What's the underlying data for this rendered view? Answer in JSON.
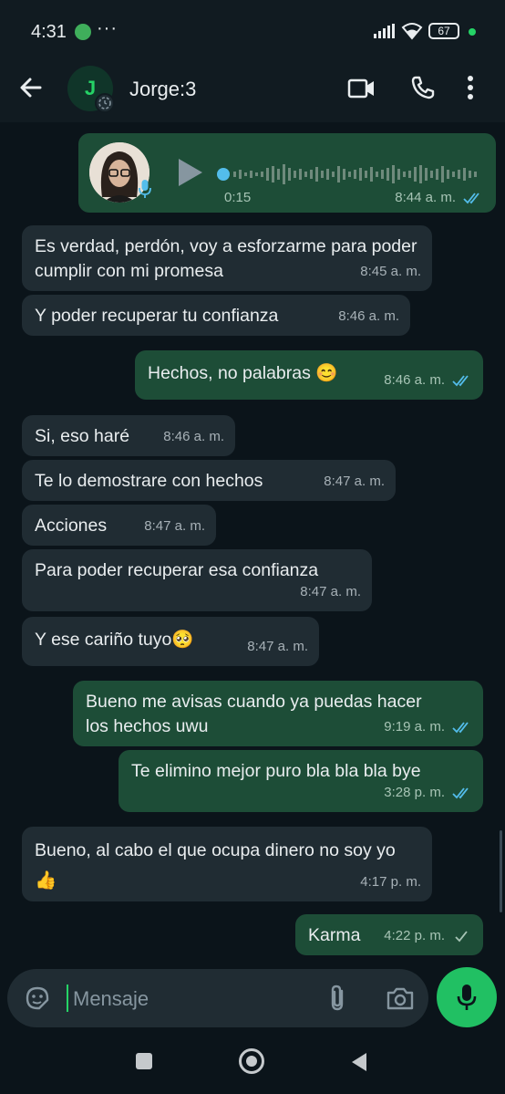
{
  "status_bar": {
    "time": "4:31",
    "dots": "···",
    "battery": "67"
  },
  "header": {
    "avatar_initial": "J",
    "contact_name": "Jorge:3"
  },
  "voice_message": {
    "duration": "0:15",
    "time": "8:44 a. m.",
    "status": "read"
  },
  "messages": [
    {
      "dir": "in",
      "text": "Es verdad, perdón, voy a esforzarme para poder cumplir con mi promesa",
      "time": "8:45 a. m."
    },
    {
      "dir": "in",
      "text": "Y poder recuperar tu confianza",
      "time": "8:46 a. m."
    },
    {
      "dir": "out",
      "text": "Hechos, no palabras 😊",
      "time": "8:46 a. m.",
      "status": "read"
    },
    {
      "dir": "in",
      "text": "Si, eso haré",
      "time": "8:46 a. m."
    },
    {
      "dir": "in",
      "text": "Te lo demostrare con hechos",
      "time": "8:47 a. m."
    },
    {
      "dir": "in",
      "text": "Acciones",
      "time": "8:47 a. m."
    },
    {
      "dir": "in",
      "text": "Para poder recuperar esa confianza",
      "time": "8:47 a. m."
    },
    {
      "dir": "in",
      "text": "Y ese cariño tuyo🥺",
      "time": "8:47 a. m."
    },
    {
      "dir": "out",
      "text": "Bueno me avisas cuando ya puedas hacer los hechos uwu",
      "time": "9:19 a. m.",
      "status": "read"
    },
    {
      "dir": "out",
      "text": "Te elimino mejor puro bla bla bla bye",
      "time": "3:28 p. m.",
      "status": "read"
    },
    {
      "dir": "in",
      "text": "Bueno, al cabo el que ocupa dinero no soy yo 👍",
      "time": "4:17 p. m."
    },
    {
      "dir": "out",
      "text": "Karma",
      "time": "4:22 p. m.",
      "status": "delivered"
    }
  ],
  "composer": {
    "placeholder": "Mensaje"
  },
  "colors": {
    "background": "#0b141a",
    "bar": "#111b21",
    "incoming_bubble": "#202c33",
    "outgoing_bubble": "#1d4d37",
    "read_ticks": "#53bdeb",
    "accent": "#21c063"
  }
}
